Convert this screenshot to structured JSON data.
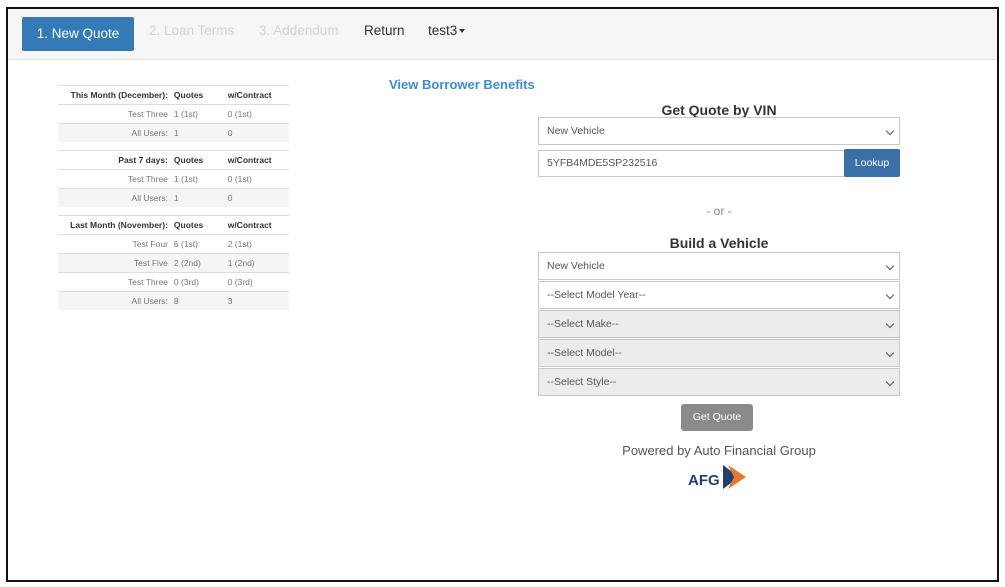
{
  "nav": {
    "tabs": [
      "1. New Quote",
      "2. Loan Terms",
      "3. Addendum",
      "Return",
      "test3"
    ]
  },
  "stats": {
    "groups": [
      {
        "header": [
          "This Month (December):",
          "Quotes",
          "w/Contract"
        ],
        "rows": [
          [
            "Test Three",
            "1  (1st)",
            "0  (1st)"
          ],
          [
            "All Users:",
            "1",
            "0"
          ]
        ]
      },
      {
        "header": [
          "Past 7 days:",
          "Quotes",
          "w/Contract"
        ],
        "rows": [
          [
            "Test Three",
            "1  (1st)",
            "0  (1st)"
          ],
          [
            "All Users:",
            "1",
            "0"
          ]
        ]
      },
      {
        "header": [
          "Last Month (November):",
          "Quotes",
          "w/Contract"
        ],
        "rows": [
          [
            "Test Four",
            "6  (1st)",
            "2  (1st)"
          ],
          [
            "Test Five",
            "2  (2nd)",
            "1  (2nd)"
          ],
          [
            "Test Three",
            "0  (3rd)",
            "0  (3rd)"
          ],
          [
            "All Users:",
            "8",
            "3"
          ]
        ]
      }
    ]
  },
  "benefits_link": "View Borrower Benefits",
  "vin_section": {
    "title": "Get Quote by VIN",
    "condition": "New Vehicle",
    "vin_value": "5YFB4MDE5SP232516",
    "lookup_label": "Lookup"
  },
  "or_text": "- or -",
  "build_section": {
    "title": "Build a Vehicle",
    "condition": "New Vehicle",
    "year": "--Select Model Year--",
    "make": "--Select Make--",
    "model": "--Select Model--",
    "style": "--Select Style--"
  },
  "get_quote_label": "Get Quote",
  "powered_by": "Powered by Auto Financial Group",
  "logo_text": "AFG"
}
